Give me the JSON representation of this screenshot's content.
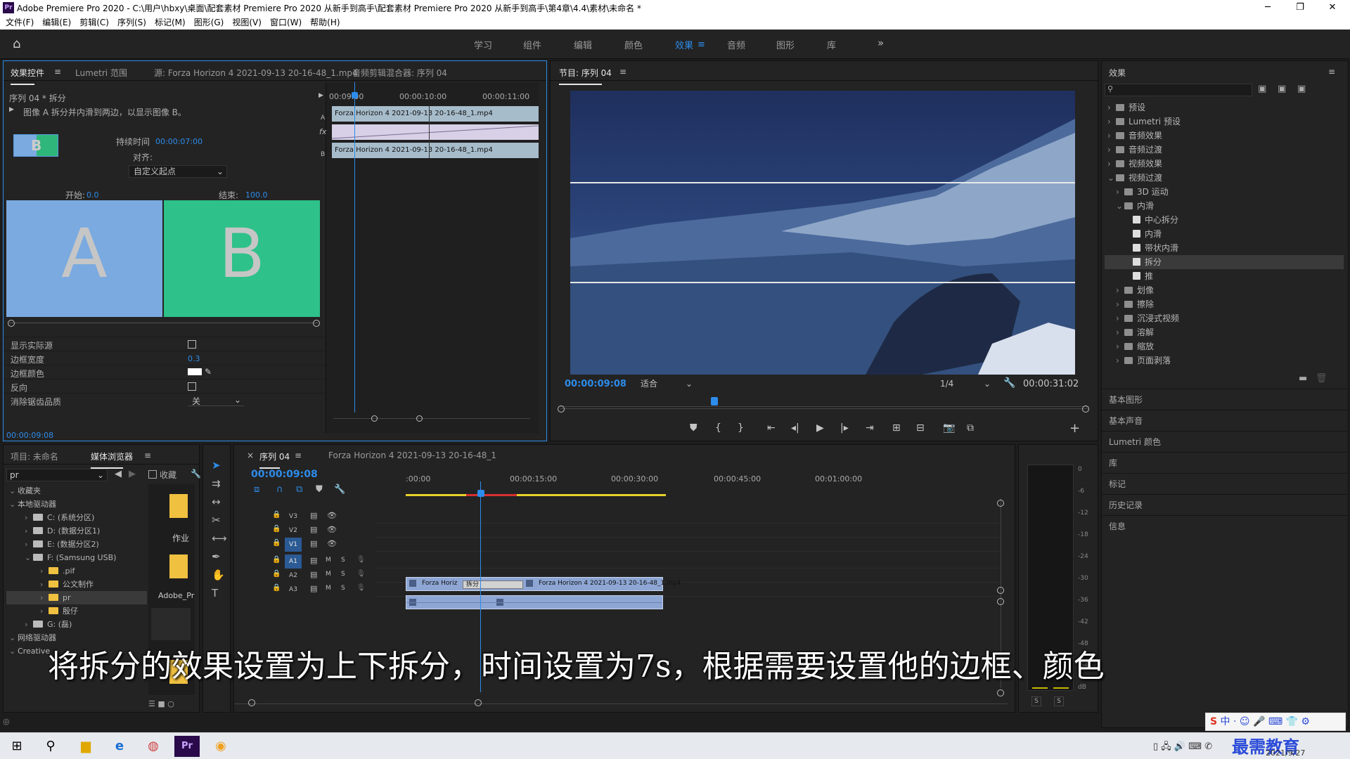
{
  "app": {
    "title": "Adobe Premiere Pro 2020 - C:\\用户\\hbxy\\桌面\\配套素材 Premiere Pro 2020 从新手到高手\\配套素材 Premiere Pro 2020 从新手到高手\\第4章\\4.4\\素材\\未命名 *",
    "logo": "Pr"
  },
  "menu": [
    "文件(F)",
    "编辑(E)",
    "剪辑(C)",
    "序列(S)",
    "标记(M)",
    "图形(G)",
    "视图(V)",
    "窗口(W)",
    "帮助(H)"
  ],
  "workspaces": [
    "学习",
    "组件",
    "编辑",
    "颜色",
    "效果",
    "音频",
    "图形",
    "库"
  ],
  "workspace_active": "效果",
  "source_panel": {
    "tabs": [
      "效果控件",
      "Lumetri 范围",
      "源: Forza Horizon 4 2021-09-13 20-16-48_1.mp4",
      "音频剪辑混合器: 序列 04"
    ],
    "breadcrumb": "序列 04 * 拆分",
    "description": "图像 A 拆分并内滑到两边，以显示图像 B。",
    "duration_label": "持续时间",
    "duration_value": "00:00:07:00",
    "align_label": "对齐:",
    "align_value": "自定义起点",
    "start_label": "开始:",
    "start_value": "0.0",
    "end_label": "结束:",
    "end_value": "100.0",
    "letter_a": "A",
    "letter_b": "B",
    "letter_thumb": "B",
    "props": [
      {
        "label": "显示实际源"
      },
      {
        "label": "边框宽度",
        "value": "0.3"
      },
      {
        "label": "边框颜色"
      },
      {
        "label": "反向"
      },
      {
        "label": "消除锯齿品质",
        "value": "关"
      }
    ],
    "timecode": "00:00:09:08",
    "mini_timeline": {
      "ticks": [
        "00:09:00",
        "00:00:10:00",
        "00:00:11:00"
      ],
      "clip_a": "Forza Horizon 4 2021-09-13 20-16-48_1.mp4",
      "clip_b": "Forza Horizon 4 2021-09-13 20-16-48_1.mp4",
      "track_a": "A",
      "track_b": "B",
      "fx": "fx"
    }
  },
  "program": {
    "title": "节目: 序列 04",
    "timecode": "00:00:09:08",
    "fit": "适合",
    "quality": "1/4",
    "duration": "00:00:31:02"
  },
  "effects_panel": {
    "title": "效果",
    "tree": [
      {
        "label": "预设",
        "indent": 0,
        "open": false
      },
      {
        "label": "Lumetri 预设",
        "indent": 0,
        "open": false
      },
      {
        "label": "音频效果",
        "indent": 0,
        "open": false
      },
      {
        "label": "音频过渡",
        "indent": 0,
        "open": false
      },
      {
        "label": "视频效果",
        "indent": 0,
        "open": false
      },
      {
        "label": "视频过渡",
        "indent": 0,
        "open": true
      },
      {
        "label": "3D 运动",
        "indent": 1,
        "open": false
      },
      {
        "label": "内滑",
        "indent": 1,
        "open": true
      },
      {
        "label": "中心拆分",
        "indent": 2,
        "leaf": true
      },
      {
        "label": "内滑",
        "indent": 2,
        "leaf": true
      },
      {
        "label": "带状内滑",
        "indent": 2,
        "leaf": true
      },
      {
        "label": "拆分",
        "indent": 2,
        "leaf": true,
        "selected": true
      },
      {
        "label": "推",
        "indent": 2,
        "leaf": true
      },
      {
        "label": "划像",
        "indent": 1,
        "open": false
      },
      {
        "label": "擦除",
        "indent": 1,
        "open": false
      },
      {
        "label": "沉浸式视频",
        "indent": 1,
        "open": false
      },
      {
        "label": "溶解",
        "indent": 1,
        "open": false
      },
      {
        "label": "缩放",
        "indent": 1,
        "open": false
      },
      {
        "label": "页面剥落",
        "indent": 1,
        "open": false
      }
    ],
    "sections": [
      "基本图形",
      "基本声音",
      "Lumetri 颜色",
      "库",
      "标记",
      "历史记录",
      "信息"
    ]
  },
  "project": {
    "tabs": [
      "项目: 未命名",
      "媒体浏览器"
    ],
    "search": "pr",
    "favorites_label": "收藏",
    "tree": [
      {
        "label": "收藏夹",
        "indent": 0
      },
      {
        "label": "本地驱动器",
        "indent": 0
      },
      {
        "label": "C: (系统分区)",
        "indent": 1
      },
      {
        "label": "D: (数据分区1)",
        "indent": 1
      },
      {
        "label": "E: (数据分区2)",
        "indent": 1
      },
      {
        "label": "F: (Samsung USB)",
        "indent": 1
      },
      {
        "label": ".pif",
        "indent": 2
      },
      {
        "label": "公文制作",
        "indent": 2
      },
      {
        "label": "pr",
        "indent": 2,
        "selected": true
      },
      {
        "label": "殷仔",
        "indent": 2
      },
      {
        "label": "G: (磊)",
        "indent": 1
      },
      {
        "label": "网络驱动器",
        "indent": 0
      },
      {
        "label": "Creative",
        "indent": 0
      }
    ],
    "thumbs": [
      "作业",
      "Adobe_Pr"
    ]
  },
  "timeline": {
    "tabs": [
      "序列 04",
      "Forza Horizon 4 2021-09-13 20-16-48_1"
    ],
    "timecode": "00:00:09:08",
    "ruler": [
      ":00:00",
      "00:00:15:00",
      "00:00:30:00",
      "00:00:45:00",
      "00:01:00:00"
    ],
    "tracks": [
      "V3",
      "V2",
      "V1",
      "A1",
      "A2",
      "A3"
    ],
    "clip1": "Forza Horiz",
    "transition": "拆分",
    "clip2": "Forza Horizon 4 2021-09-13 20-16-48_1.mp4",
    "meter": [
      "0",
      "-6",
      "-12",
      "-18",
      "-24",
      "-30",
      "-36",
      "-42",
      "-48",
      "-54",
      "dB"
    ],
    "meter_solo": [
      "S",
      "S"
    ]
  },
  "subtitle": "将拆分的效果设置为上下拆分，时间设置为7s，根据需要设置他的边框、颜色",
  "taskbar": {
    "clock": "2021/9/27",
    "watermark": "最需教育",
    "ime": "中"
  }
}
